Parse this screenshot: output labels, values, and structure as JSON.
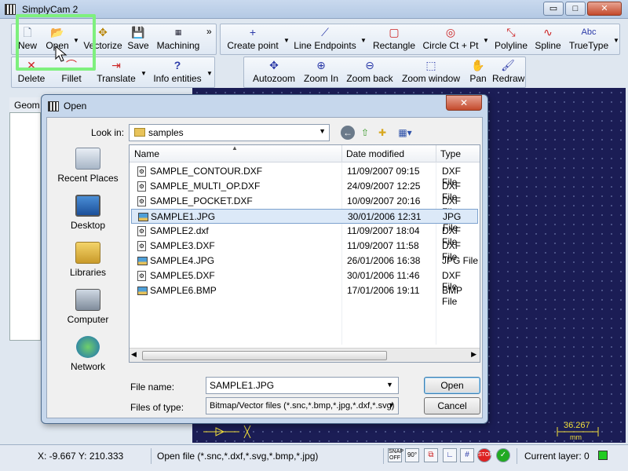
{
  "app": {
    "title": "SimplyCam 2",
    "window_buttons": {
      "minimize": "▭",
      "maximize": "□",
      "close": "✕"
    }
  },
  "toolbar1": {
    "new": "New",
    "open": "Open",
    "vectorize": "Vectorize",
    "save": "Save",
    "machining": "Machining",
    "more": "»"
  },
  "toolbar2": {
    "create_point": "Create point",
    "line_endpoints": "Line Endpoints",
    "rectangle": "Rectangle",
    "circle": "Circle Ct + Pt",
    "polyline": "Polyline",
    "spline": "Spline",
    "truetype": "TrueType"
  },
  "toolbar3": {
    "delete": "Delete",
    "fillet": "Fillet",
    "translate": "Translate",
    "info": "Info entities"
  },
  "toolbar4": {
    "autozoom": "Autozoom",
    "zoom_in": "Zoom In",
    "zoom_back": "Zoom back",
    "zoom_window": "Zoom window",
    "pan": "Pan",
    "redraw": "Redraw"
  },
  "geometry_panel": {
    "tab": "Geom"
  },
  "canvas": {
    "scale_value": "36.267",
    "scale_unit": "mm"
  },
  "statusbar": {
    "coords": "X: -9.667 Y: 210.333",
    "message": "Open file (*.snc,*.dxf,*.svg,*.bmp,*.jpg)",
    "layer": "Current layer: 0",
    "layer_color": "#22cc22",
    "snap": "SNAP OFF",
    "angle": "90°"
  },
  "dialog": {
    "title": "Open",
    "close": "✕",
    "look_in_label": "Look in:",
    "look_in_value": "samples",
    "places": [
      {
        "label": "Recent Places",
        "icon": "recent-places-icon"
      },
      {
        "label": "Desktop",
        "icon": "desktop-icon"
      },
      {
        "label": "Libraries",
        "icon": "libraries-icon"
      },
      {
        "label": "Computer",
        "icon": "computer-icon"
      },
      {
        "label": "Network",
        "icon": "network-icon"
      }
    ],
    "columns": {
      "name": "Name",
      "date": "Date modified",
      "type": "Type"
    },
    "files": [
      {
        "name": "SAMPLE_CONTOUR.DXF",
        "date": "11/09/2007 09:15",
        "type": "DXF File",
        "kind": "dxf"
      },
      {
        "name": "SAMPLE_MULTI_OP.DXF",
        "date": "24/09/2007 12:25",
        "type": "DXF File",
        "kind": "dxf"
      },
      {
        "name": "SAMPLE_POCKET.DXF",
        "date": "10/09/2007 20:16",
        "type": "DXF File",
        "kind": "dxf"
      },
      {
        "name": "SAMPLE1.JPG",
        "date": "30/01/2006 12:31",
        "type": "JPG File",
        "kind": "img",
        "selected": true
      },
      {
        "name": "SAMPLE2.dxf",
        "date": "11/09/2007 18:04",
        "type": "DXF File",
        "kind": "dxf"
      },
      {
        "name": "SAMPLE3.DXF",
        "date": "11/09/2007 11:58",
        "type": "DXF File",
        "kind": "dxf"
      },
      {
        "name": "SAMPLE4.JPG",
        "date": "26/01/2006 16:38",
        "type": "JPG File",
        "kind": "img"
      },
      {
        "name": "SAMPLE5.DXF",
        "date": "30/01/2006 11:46",
        "type": "DXF File",
        "kind": "dxf"
      },
      {
        "name": "SAMPLE6.BMP",
        "date": "17/01/2006 19:11",
        "type": "BMP File",
        "kind": "img"
      }
    ],
    "file_name_label": "File name:",
    "file_name_value": "SAMPLE1.JPG",
    "file_type_label": "Files of type:",
    "file_type_value": "Bitmap/Vector files (*.snc,*.bmp,*.jpg,*.dxf,*.svg)",
    "open_button": "Open",
    "cancel_button": "Cancel"
  }
}
